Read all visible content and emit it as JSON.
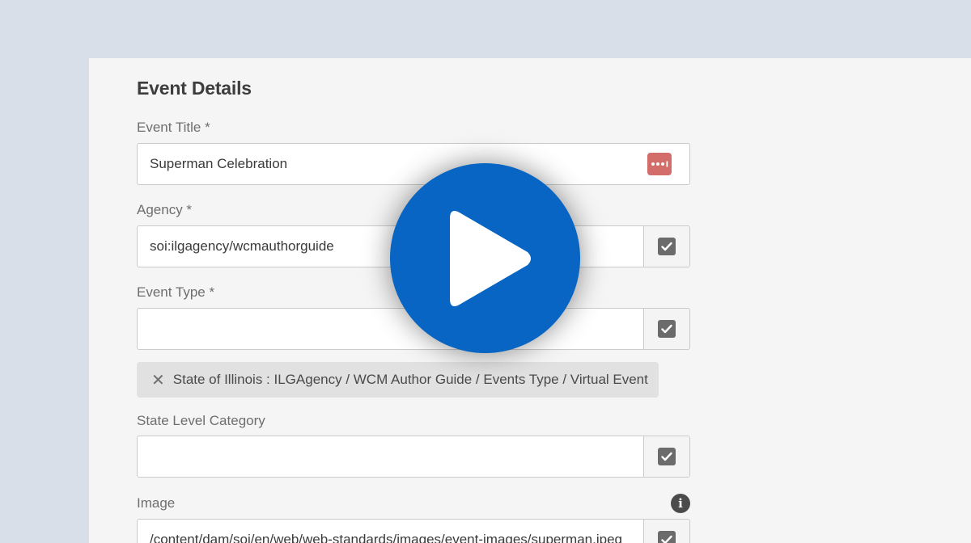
{
  "form": {
    "section_title": "Event Details",
    "event_title": {
      "label": "Event Title *",
      "value": "Superman Celebration"
    },
    "agency": {
      "label": "Agency *",
      "value": "soi:ilgagency/wcmauthorguide"
    },
    "event_type": {
      "label": "Event Type *",
      "value": "",
      "tag": "State of Illinois : ILGAgency / WCM Author Guide / Events Type / Virtual Event"
    },
    "state_level_category": {
      "label": "State Level Category",
      "value": ""
    },
    "image": {
      "label": "Image",
      "value": "/content/dam/soi/en/web/web-standards/images/event-images/superman.jpeg"
    }
  },
  "icons": {
    "dots": "more-dots-icon",
    "checkbox": "checkbox-checked-icon",
    "remove": "close-icon",
    "info": "info-icon",
    "play": "play-icon"
  },
  "colors": {
    "background": "#d9dfe8",
    "panel": "#f5f5f5",
    "play_button": "#0865c4",
    "dots_badge": "#d26d6a",
    "checkbox": "#6b6b6b"
  }
}
